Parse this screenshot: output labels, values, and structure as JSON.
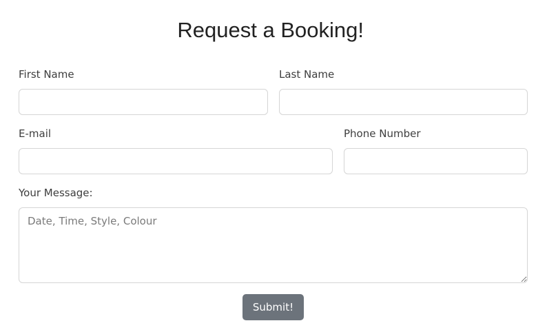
{
  "form": {
    "title": "Request a Booking!",
    "first_name_label": "First Name",
    "first_name_value": "",
    "last_name_label": "Last Name",
    "last_name_value": "",
    "email_label": "E-mail",
    "email_value": "",
    "phone_label": "Phone Number",
    "phone_value": "",
    "message_label": "Your Message:",
    "message_placeholder": "Date, Time, Style, Colour",
    "submit_label": "Submit!"
  },
  "colors": {
    "title_underline": "#2f9e74",
    "submit_background": "#6c737b",
    "field_border": "#d5d5d5"
  }
}
